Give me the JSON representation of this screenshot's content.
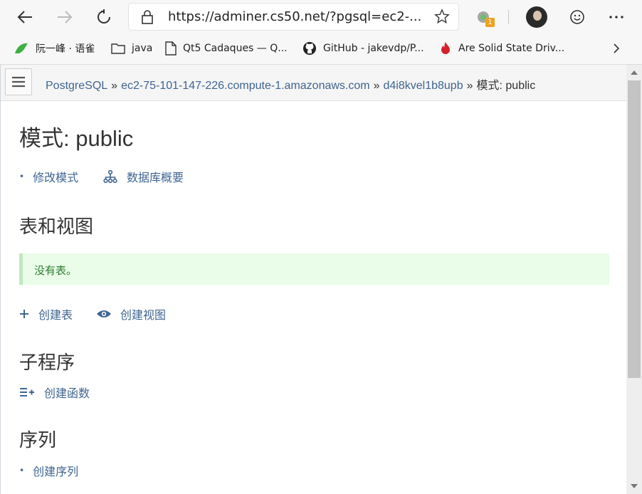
{
  "browser": {
    "url": "https://adminer.cs50.net/?pgsql=ec2-...",
    "extension_badge": "1",
    "bookmarks": [
      {
        "label": "阮一峰 · 语雀",
        "icon": "bird-icon"
      },
      {
        "label": "java",
        "icon": "folder-icon"
      },
      {
        "label": "Qt5 Cadaques — Q...",
        "icon": "page-icon"
      },
      {
        "label": "GitHub - jakevdp/P...",
        "icon": "github-icon"
      },
      {
        "label": "Are Solid State Driv...",
        "icon": "flame-icon"
      }
    ]
  },
  "breadcrumb": {
    "items": [
      "PostgreSQL",
      "ec2-75-101-147-226.compute-1.amazonaws.com",
      "d4i8kvel1b8upb"
    ],
    "current": "模式: public",
    "separator": "»"
  },
  "content": {
    "title": "模式: public",
    "links_top": {
      "alter_schema": "修改模式",
      "db_overview": "数据库概要"
    },
    "tables_heading": "表和视图",
    "no_tables_message": "没有表。",
    "create_table": "创建表",
    "create_view": "创建视图",
    "routines_heading": "子程序",
    "create_function": "创建函数",
    "sequences_heading": "序列",
    "create_sequence": "创建序列"
  },
  "colors": {
    "link": "#3f6591",
    "success_bg": "#e9fde9",
    "success_text": "#2d7d2d"
  }
}
